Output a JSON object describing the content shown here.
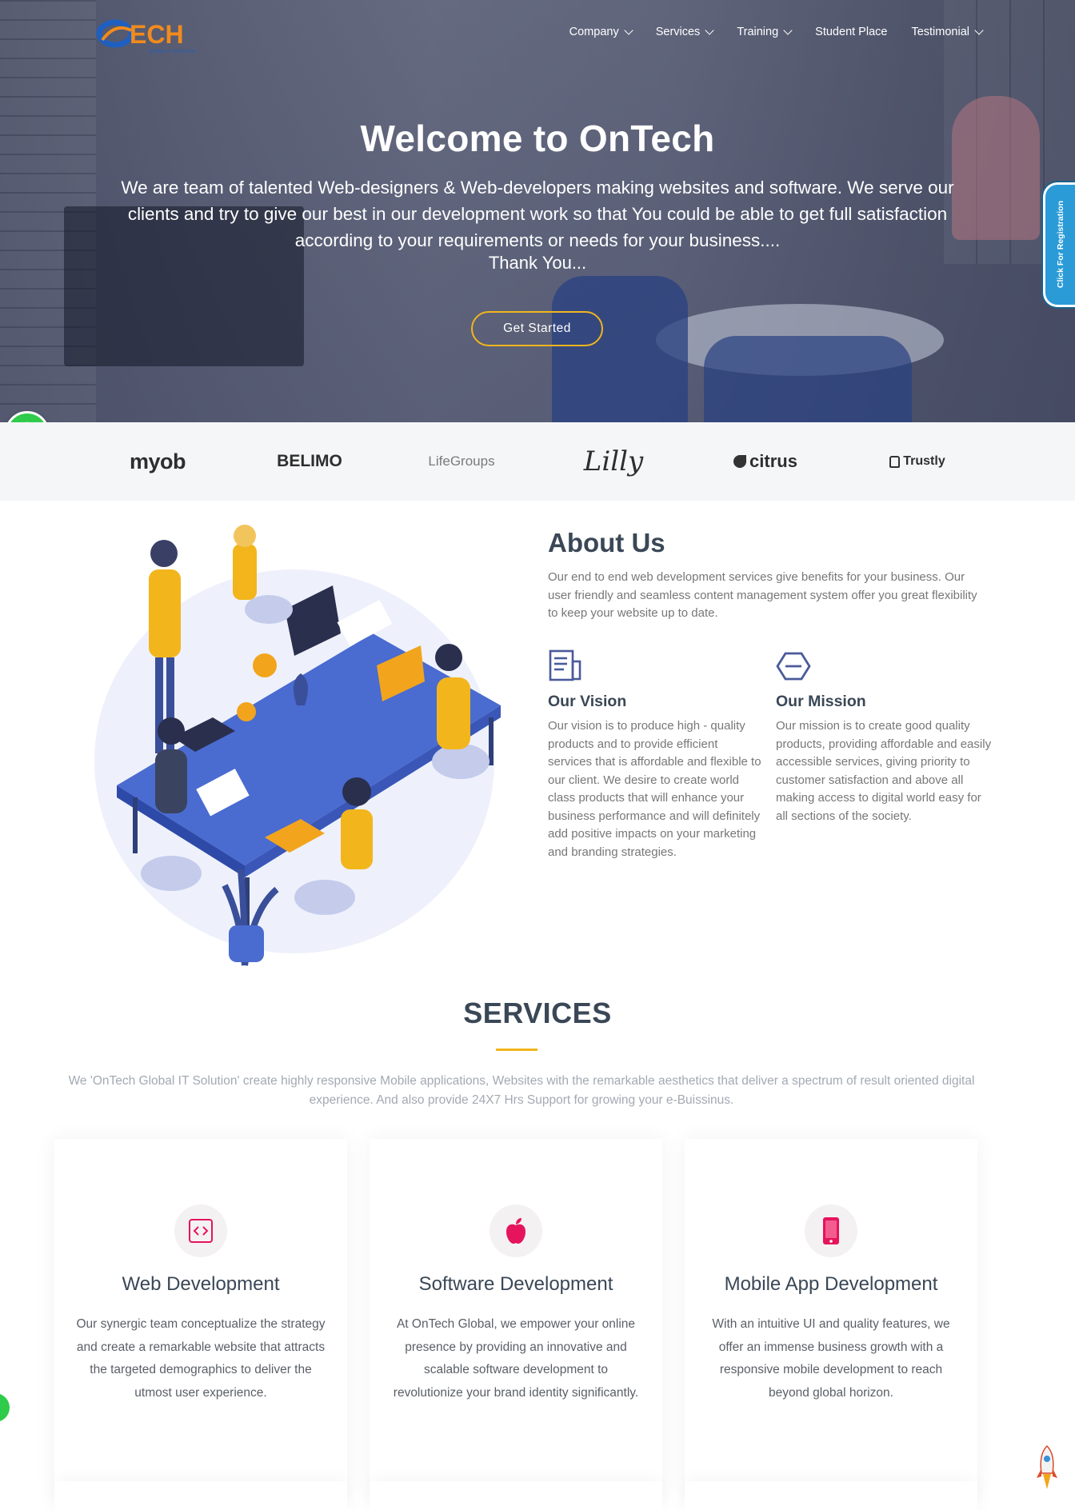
{
  "brand": {
    "logo_text": "ECH",
    "logo_sub": "GLOBAL IT SOLUTION",
    "accent": "#f2b51c",
    "primary_dark": "#3a4756"
  },
  "nav": {
    "items": [
      {
        "label": "Company",
        "has_dropdown": true
      },
      {
        "label": "Services",
        "has_dropdown": true
      },
      {
        "label": "Training",
        "has_dropdown": true
      },
      {
        "label": "Student Place",
        "has_dropdown": false
      },
      {
        "label": "Testimonial",
        "has_dropdown": true
      }
    ]
  },
  "hero": {
    "title": "Welcome to OnTech",
    "text": "We are team of talented Web-designers & Web-developers making websites and software. We serve our clients and try to give our best in our development work so that You could be able to get full satisfaction according to your requirements or needs for your business....",
    "thanks": "Thank You...",
    "cta_label": "Get Started",
    "registration_tab": "Click For Registration"
  },
  "clients": [
    {
      "name": "myob"
    },
    {
      "name": "BELIMO"
    },
    {
      "name": "LifeGroups"
    },
    {
      "name": "Lilly"
    },
    {
      "name": "citrus"
    },
    {
      "name": "Trustly"
    }
  ],
  "about": {
    "title": "About Us",
    "text": "Our end to end web development services give benefits for your business. Our user friendly and seamless content management system offer you great flexibility to keep your website up to date.",
    "vision": {
      "icon": "document-icon",
      "title": "Our Vision",
      "text": "Our vision is to produce high - quality products and to provide efficient services that is affordable and flexible to our client. We desire to create world class products that will enhance your business performance and will definitely add positive impacts on your marketing and branding strategies."
    },
    "mission": {
      "icon": "hexagon-icon",
      "title": "Our Mission",
      "text": "Our mission is to create good quality products, providing affordable and easily accessible services, giving priority to customer satisfaction and above all making access to digital world easy for all sections of the society."
    }
  },
  "services": {
    "title": "SERVICES",
    "subtitle": "We 'OnTech Global IT Solution' create highly responsive Mobile applications, Websites with the remarkable aesthetics that deliver a spectrum of result oriented digital experience. And also provide 24X7 Hrs Support for growing your e-Buissinus.",
    "icon_color": "#e5145d",
    "cards": [
      {
        "icon": "code-icon",
        "title": "Web Development",
        "text": "Our synergic team conceptualize the strategy and create a remarkable website that attracts the targeted demographics to deliver the utmost user experience."
      },
      {
        "icon": "apple-icon",
        "title": "Software Development",
        "text": "At OnTech Global, we empower your online presence by providing an innovative and scalable software development to revolutionize your brand identity significantly."
      },
      {
        "icon": "smartphone-icon",
        "title": "Mobile App Development",
        "text": "With an intuitive UI and quality features, we offer an immense business growth with a responsive mobile development to reach beyond global horizon."
      }
    ]
  }
}
